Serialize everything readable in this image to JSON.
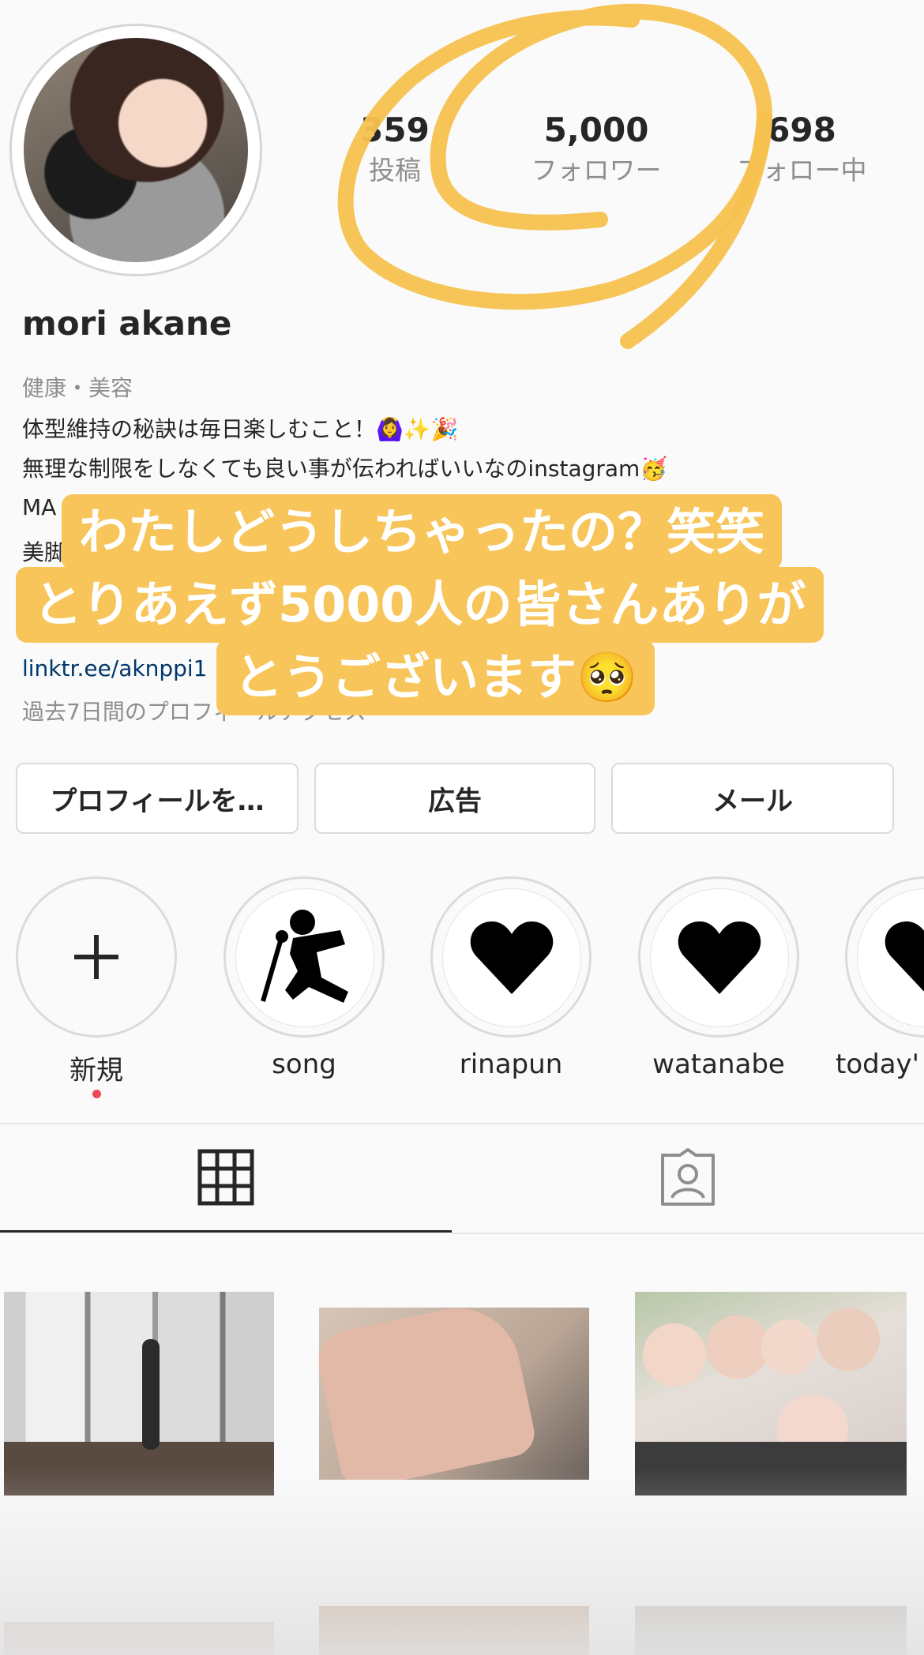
{
  "profile": {
    "username": "mori akane",
    "stats": [
      {
        "value": "359",
        "label": "投稿"
      },
      {
        "value": "5,000",
        "label": "フォロワー"
      },
      {
        "value": "698",
        "label": "フォロー中"
      }
    ],
    "category": "健康・美容",
    "bio_lines": [
      "体型維持の秘訣は毎日楽しむこと！🙆‍♀️✨🎉",
      "無理な制限をしなくても良い事が伝わればいいなのinstagram🥳",
      "MA",
      "美脚"
    ],
    "link": "linktr.ee/aknppi1",
    "insights": "過去7日間のプロフィールアクセス"
  },
  "buttons": {
    "edit_profile": "プロフィールを…",
    "ads": "広告",
    "email": "メール"
  },
  "highlights": [
    {
      "label": "新規",
      "icon": "plus-icon"
    },
    {
      "label": "song",
      "icon": "singer-icon"
    },
    {
      "label": "rinapun",
      "icon": "heart-icon"
    },
    {
      "label": "watanabe",
      "icon": "heart-icon"
    },
    {
      "label": "today'",
      "icon": "heart-icon"
    }
  ],
  "tabs": [
    {
      "name": "grid-tab",
      "icon": "grid-icon",
      "active": true
    },
    {
      "name": "tagged-tab",
      "icon": "tagged-person-icon",
      "active": false
    }
  ],
  "overlay": {
    "lines": [
      "わたしどうしちゃったの？笑笑",
      "とりあえず5000人の皆さんありが",
      "とうございます🥺"
    ]
  },
  "colors": {
    "overlay_bg": "#f7c55a",
    "circle_annotation": "#f5c14e",
    "link": "#00376b",
    "new_dot": "#ed4956"
  }
}
